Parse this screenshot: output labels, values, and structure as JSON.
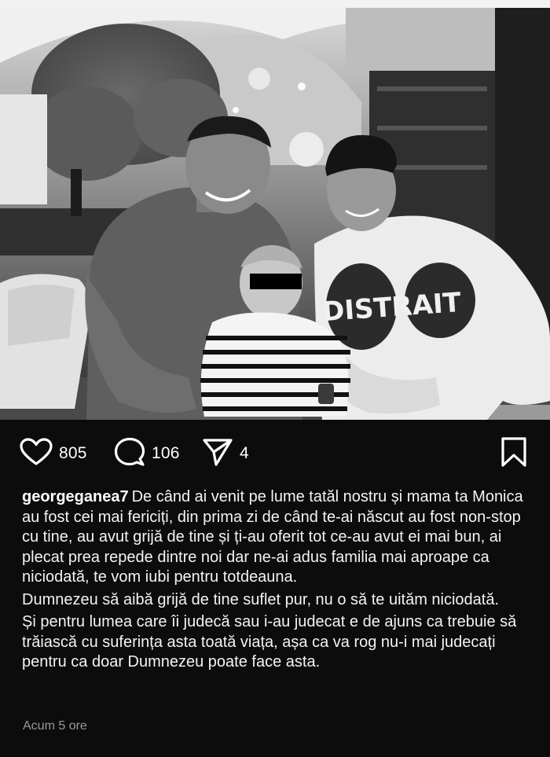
{
  "post": {
    "photo_alt": "",
    "likes": "805",
    "comments": "106",
    "shares": "4",
    "username": "georgeganea7",
    "caption_p1": "De când ai venit pe lume tatăl nostru și mama ta Monica au fost cei mai fericiți, din prima zi de când te-ai născut au fost non-stop cu tine, au avut grijă de tine și ți-au oferit tot ce-au avut ei mai bun, ai plecat prea repede dintre noi dar ne-ai adus familia mai aproape ca niciodată, te vom iubi pentru totdeauna.",
    "caption_p2": "Dumnezeu să aibă grijă de tine suflet pur, nu o să te uităm niciodată.",
    "caption_p3": "Și pentru lumea care îi judecă sau i-au judecat e de ajuns ca trebuie să trăiască cu suferința asta toată viața, așa ca va rog nu-i mai judecați pentru ca doar Dumnezeu poate face asta.",
    "timestamp": "Acum 5 ore",
    "shirt_print": "DISTRAIT"
  },
  "icons": {
    "like": "heart-icon",
    "comment": "comment-bubble-icon",
    "share": "paper-plane-icon",
    "save": "bookmark-icon"
  },
  "colors": {
    "background": "#0c0c0c",
    "text": "#f3f3f3",
    "muted": "#9a9a9a"
  }
}
